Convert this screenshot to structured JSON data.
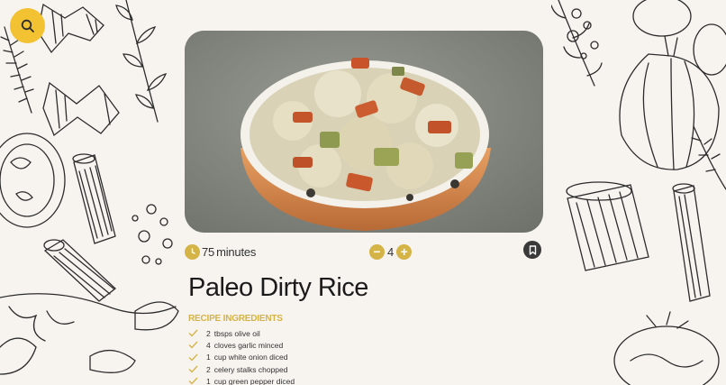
{
  "search": {
    "icon": "search-icon"
  },
  "recipe": {
    "title": "Paleo Dirty Rice",
    "time": {
      "value": "75",
      "unit": "minutes",
      "icon": "clock-icon"
    },
    "servings": {
      "count": "4",
      "decrease_label": "−",
      "increase_label": "+"
    },
    "bookmark": {
      "icon": "bookmark-icon"
    },
    "ingredients_heading": "RECIPE INGREDIENTS",
    "ingredients": [
      {
        "qty": "2",
        "text": "tbsps olive oil"
      },
      {
        "qty": "4",
        "text": "cloves garlic minced"
      },
      {
        "qty": "1",
        "text": "cup white onion diced"
      },
      {
        "qty": "2",
        "text": "celery stalks chopped"
      },
      {
        "qty": "1",
        "text": "cup green pepper diced"
      }
    ]
  },
  "colors": {
    "accent": "#d4b347",
    "search_button": "#f2c233",
    "background": "#f7f4f0",
    "dark": "#3a3a3a"
  }
}
